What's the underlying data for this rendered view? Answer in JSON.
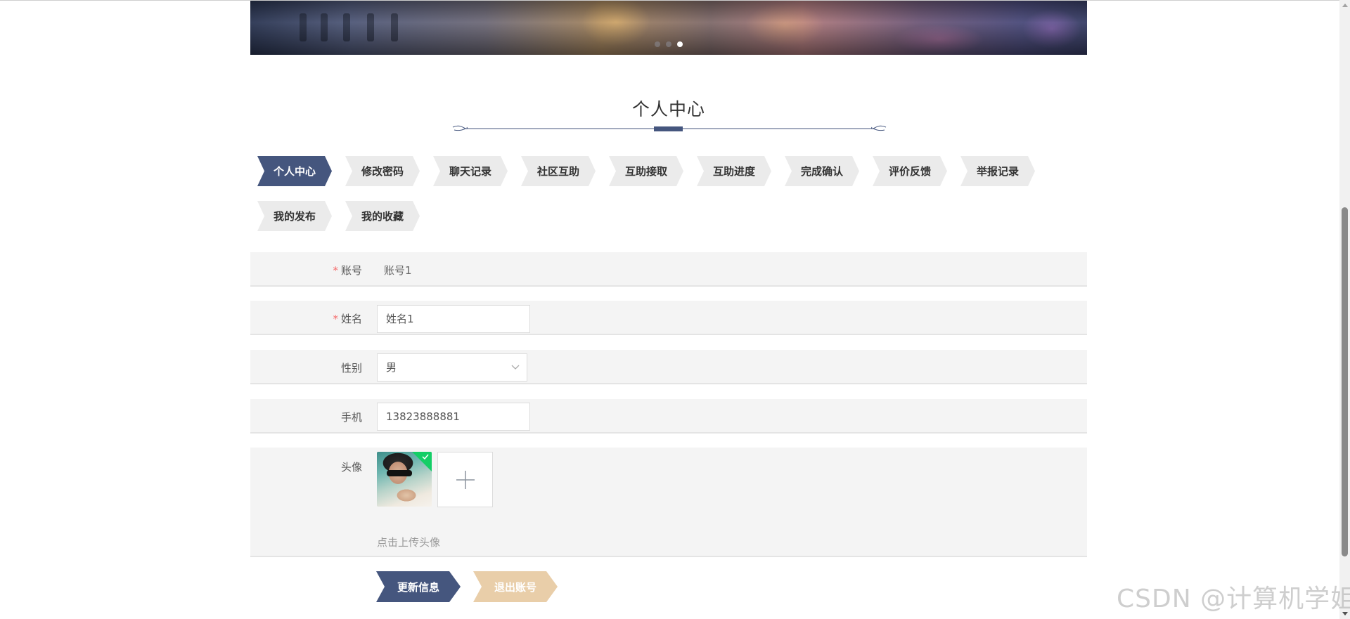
{
  "banner": {
    "slides": 3,
    "active_slide": 3
  },
  "section_title": "个人中心",
  "tabs": [
    {
      "label": "个人中心",
      "active": true
    },
    {
      "label": "修改密码",
      "active": false
    },
    {
      "label": "聊天记录",
      "active": false
    },
    {
      "label": "社区互助",
      "active": false
    },
    {
      "label": "互助接取",
      "active": false
    },
    {
      "label": "互助进度",
      "active": false
    },
    {
      "label": "完成确认",
      "active": false
    },
    {
      "label": "评价反馈",
      "active": false
    },
    {
      "label": "举报记录",
      "active": false
    },
    {
      "label": "我的发布",
      "active": false
    },
    {
      "label": "我的收藏",
      "active": false
    }
  ],
  "form": {
    "required_mark": "*",
    "account": {
      "label": "账号",
      "value": "账号1"
    },
    "name": {
      "label": "姓名",
      "value": "姓名1"
    },
    "gender": {
      "label": "性别",
      "value": "男"
    },
    "phone": {
      "label": "手机",
      "value": "13823888881"
    },
    "avatar": {
      "label": "头像",
      "hint": "点击上传头像"
    }
  },
  "buttons": {
    "update": "更新信息",
    "logout": "退出账号"
  },
  "watermark": "CSDN @计算机学姐",
  "colors": {
    "primary": "#45567e",
    "secondary": "#e9cea9",
    "required": "#f56c6c",
    "success": "#13ce66"
  }
}
